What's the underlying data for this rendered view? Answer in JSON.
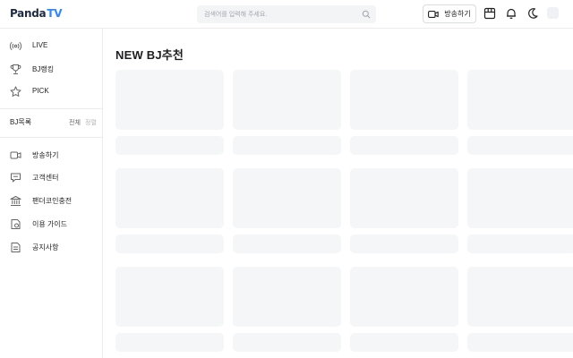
{
  "header": {
    "logo_part1": "Panda",
    "logo_part2": "TV",
    "search_placeholder": "검색어를 입력해 주세요.",
    "broadcast_label": "방송하기",
    "icons": [
      "search-icon",
      "video-camera-icon",
      "store-icon",
      "bell-icon",
      "moon-icon"
    ]
  },
  "sidebar": {
    "top_items": [
      {
        "label": "LIVE",
        "icon": "broadcast-icon"
      },
      {
        "label": "BJ랭킹",
        "icon": "trophy-icon"
      },
      {
        "label": "PICK",
        "icon": "star-icon"
      }
    ],
    "bj_section": {
      "title": "BJ목록",
      "ctrl_active": "전체",
      "ctrl_dim": "정렬"
    },
    "bottom_items": [
      {
        "label": "방송하기",
        "icon": "video-icon"
      },
      {
        "label": "고객센터",
        "icon": "chat-icon"
      },
      {
        "label": "팬더코인충전",
        "icon": "bank-icon"
      },
      {
        "label": "이용 가이드",
        "icon": "guide-icon"
      },
      {
        "label": "공지사항",
        "icon": "notice-icon"
      }
    ]
  },
  "main": {
    "title": "NEW BJ추천",
    "skeleton_rows": 3,
    "skeleton_cols": 4
  },
  "colors": {
    "accent": "#2f87ff",
    "logo_dark": "#1f2a44",
    "skeleton": "#f5f6f8",
    "border": "#ececec"
  }
}
